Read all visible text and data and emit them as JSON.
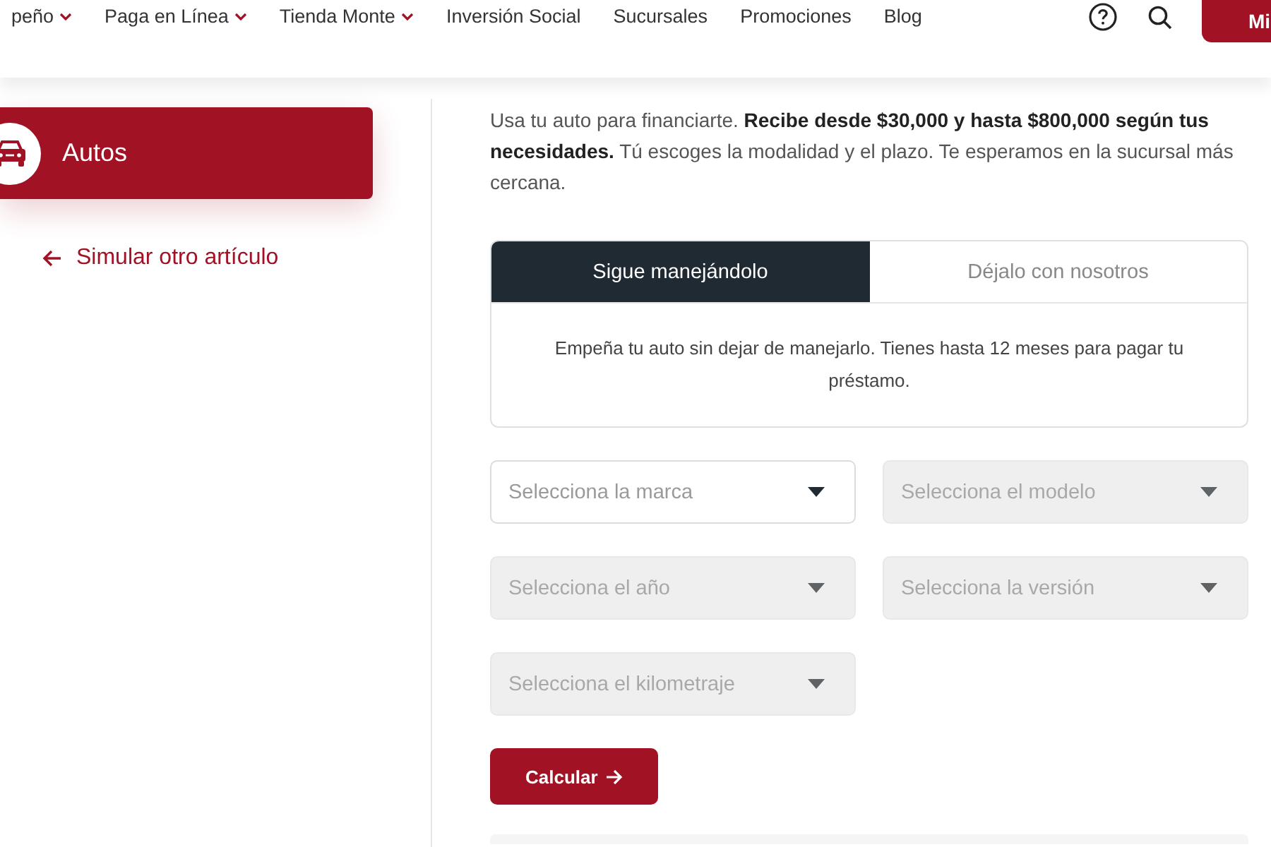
{
  "header": {
    "nav": [
      {
        "label": "peño",
        "dropdown": true
      },
      {
        "label": "Paga en Línea",
        "dropdown": true
      },
      {
        "label": "Tienda Monte",
        "dropdown": true
      },
      {
        "label": "Inversión Social",
        "dropdown": false
      },
      {
        "label": "Sucursales",
        "dropdown": false
      },
      {
        "label": "Promociones",
        "dropdown": false
      },
      {
        "label": "Blog",
        "dropdown": false
      }
    ],
    "account_button": {
      "label": "Mi"
    }
  },
  "sidebar": {
    "category": {
      "label": "Autos"
    },
    "back_link": {
      "label": "Simular otro artículo"
    }
  },
  "intro": "Usa tu auto para financiarte. **Recibe desde $30,000 y hasta $800,000 según tus necesidades.** Tú escoges la modalidad y el plazo. Te esperamos en la sucursal más cercana.",
  "tabs": [
    {
      "label": "Sigue manejándolo",
      "selected": true
    },
    {
      "label": "Déjalo con nosotros",
      "selected": false
    }
  ],
  "tab_content": "Empeña tu auto sin dejar de manejarlo. Tienes hasta 12 meses para pagar tu préstamo.",
  "selects": [
    {
      "placeholder": "Selecciona la marca",
      "disabled": false
    },
    {
      "placeholder": "Selecciona el modelo",
      "disabled": true
    },
    {
      "placeholder": "Selecciona el año",
      "disabled": true
    },
    {
      "placeholder": "Selecciona la versión",
      "disabled": true
    },
    {
      "placeholder": "Selecciona el kilometraje",
      "disabled": true
    }
  ],
  "calculate_button": {
    "label": "Calcular"
  }
}
